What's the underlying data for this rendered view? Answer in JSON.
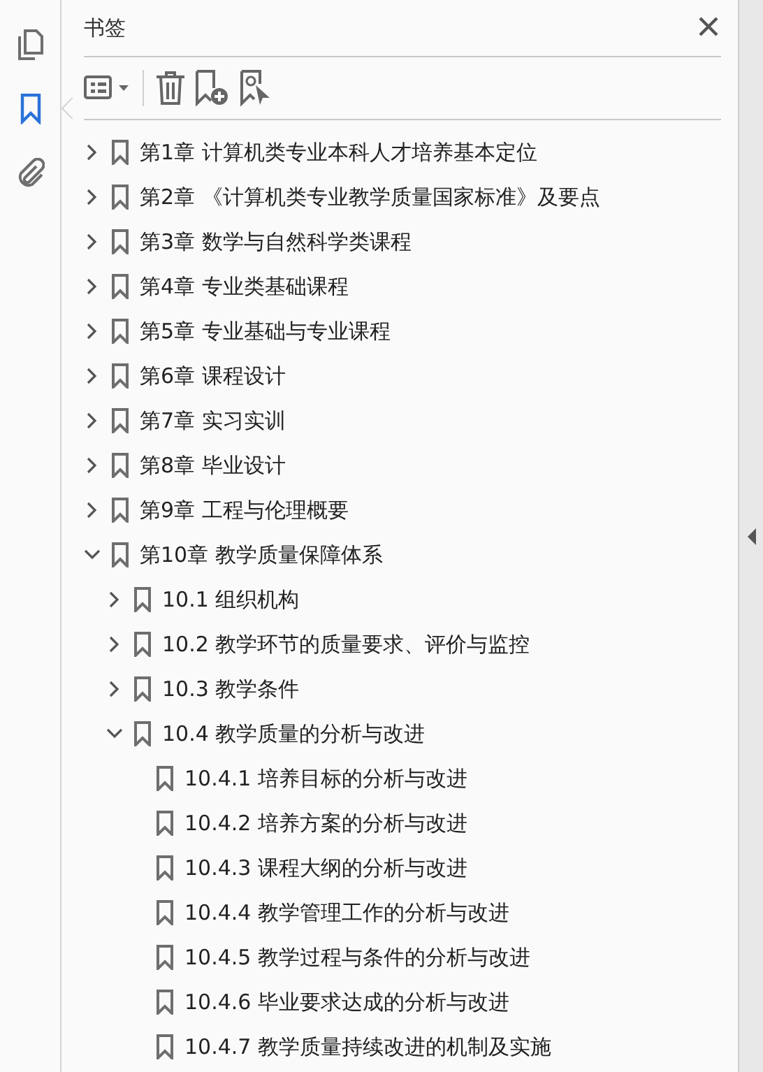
{
  "rail": [
    {
      "kind": "pages",
      "selected": false
    },
    {
      "kind": "bookmarks",
      "selected": true
    },
    {
      "kind": "attachments",
      "selected": false
    }
  ],
  "panel": {
    "title": "书签"
  },
  "bookmarks": [
    {
      "label": "第1章 计算机类专业本科人才培养基本定位",
      "expanded": false
    },
    {
      "label": "第2章 《计算机类专业教学质量国家标准》及要点",
      "expanded": false
    },
    {
      "label": "第3章 数学与自然科学类课程",
      "expanded": false
    },
    {
      "label": "第4章 专业类基础课程",
      "expanded": false
    },
    {
      "label": "第5章 专业基础与专业课程",
      "expanded": false
    },
    {
      "label": "第6章 课程设计",
      "expanded": false
    },
    {
      "label": "第7章 实习实训",
      "expanded": false
    },
    {
      "label": "第8章 毕业设计",
      "expanded": false
    },
    {
      "label": "第9章 工程与伦理概要",
      "expanded": false
    },
    {
      "label": "第10章 教学质量保障体系",
      "expanded": true,
      "children": [
        {
          "label": "10.1 组织机构",
          "expanded": false
        },
        {
          "label": "10.2 教学环节的质量要求、评价与监控",
          "expanded": false
        },
        {
          "label": "10.3 教学条件",
          "expanded": false
        },
        {
          "label": "10.4 教学质量的分析与改进",
          "expanded": true,
          "children": [
            {
              "label": "10.4.1 培养目标的分析与改进"
            },
            {
              "label": "10.4.2 培养方案的分析与改进"
            },
            {
              "label": "10.4.3 课程大纲的分析与改进"
            },
            {
              "label": "10.4.4 教学管理工作的分析与改进"
            },
            {
              "label": "10.4.5 教学过程与条件的分析与改进"
            },
            {
              "label": "10.4.6 毕业要求达成的分析与改进"
            },
            {
              "label": "10.4.7 教学质量持续改进的机制及实施"
            }
          ]
        }
      ]
    }
  ]
}
